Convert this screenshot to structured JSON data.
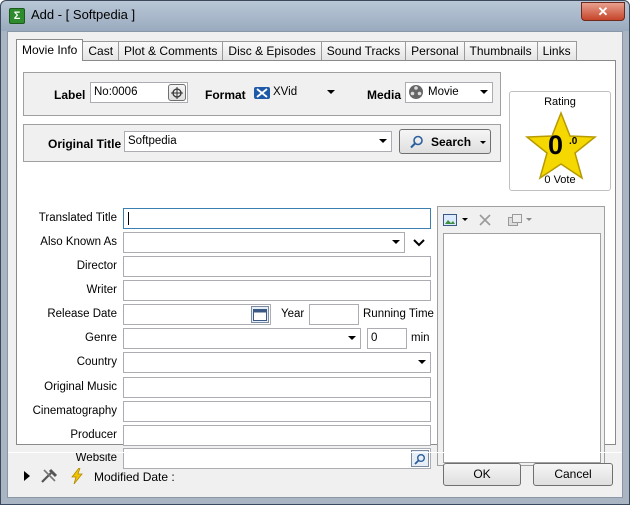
{
  "window": {
    "title": "Add - [ Softpedia ]",
    "close_label": "✕"
  },
  "tabs": [
    {
      "label": "Movie Info",
      "active": true
    },
    {
      "label": "Cast"
    },
    {
      "label": "Plot & Comments"
    },
    {
      "label": "Disc & Episodes"
    },
    {
      "label": "Sound Tracks"
    },
    {
      "label": "Personal"
    },
    {
      "label": "Thumbnails"
    },
    {
      "label": "Links"
    }
  ],
  "header": {
    "label_label": "Label",
    "label_value": "No:0006",
    "format_label": "Format",
    "format_value": "XVid",
    "media_label": "Media",
    "media_value": "Movie",
    "original_title_label": "Original Title",
    "original_title_value": "Softpedia",
    "search_label": "Search"
  },
  "rating": {
    "title": "Rating",
    "value": "0",
    "decimal": ".0",
    "votes": "0 Vote"
  },
  "form": {
    "translated_title": "Translated Title",
    "also_known_as": "Also Known As",
    "director": "Director",
    "writer": "Writer",
    "release_date": "Release Date",
    "year": "Year",
    "running_time": "Running Time",
    "genre": "Genre",
    "runtime_value": "0",
    "min": "min",
    "country": "Country",
    "original_music": "Original Music",
    "cinematography": "Cinematography",
    "producer": "Producer",
    "website": "Website"
  },
  "footer": {
    "modified_date": "Modified Date :",
    "ok": "OK",
    "cancel": "Cancel"
  },
  "colors": {
    "star": "#f5d800",
    "titlebar": "#a9b8c9",
    "accent_blue": "#3c7fb1"
  }
}
